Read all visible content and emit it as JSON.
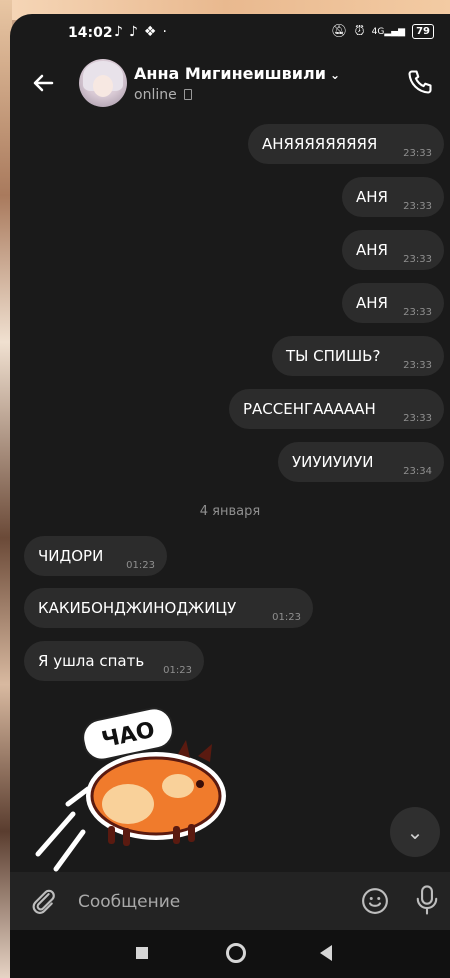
{
  "status_bar": {
    "time": "14:02",
    "battery": "79",
    "network": "4G"
  },
  "header": {
    "contact_name": "Анна Мигинеишвили",
    "status": "online"
  },
  "messages_out": [
    {
      "text": "АНЯЯЯЯЯЯЯЯЯ",
      "time": "23:33"
    },
    {
      "text": "АНЯ",
      "time": "23:33"
    },
    {
      "text": "АНЯ",
      "time": "23:33"
    },
    {
      "text": "АНЯ",
      "time": "23:33"
    },
    {
      "text": "ТЫ СПИШЬ?",
      "time": "23:33"
    },
    {
      "text": "РАССЕНГАААААН",
      "time": "23:33"
    },
    {
      "text": "УИУИУИУИ",
      "time": "23:34"
    }
  ],
  "date_separator": "4 января",
  "messages_in": [
    {
      "text": "ЧИДОРИ",
      "time": "01:23"
    },
    {
      "text": "КАКИБОНДЖИНОДЖИЦУ",
      "time": "01:23"
    },
    {
      "text": "Я ушла спать",
      "time": "01:23"
    }
  ],
  "sticker": {
    "caption": "ЧАО"
  },
  "composer": {
    "placeholder": "Сообщение"
  },
  "icons": {
    "back": "arrow-left-icon",
    "call": "phone-icon",
    "attach": "paperclip-icon",
    "emoji": "smile-icon",
    "mic": "microphone-icon",
    "scroll": "chevron-down-icon"
  }
}
